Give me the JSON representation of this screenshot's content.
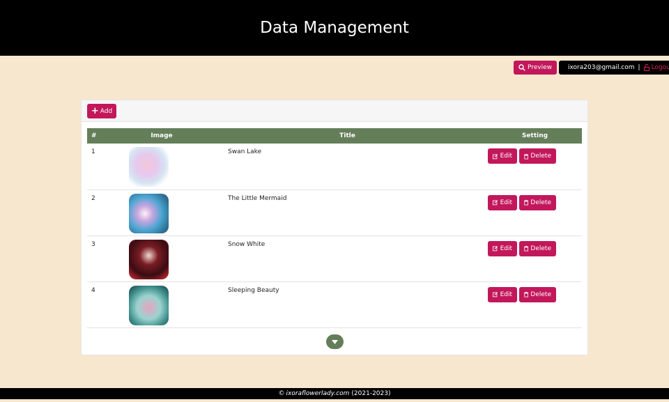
{
  "header": {
    "title": "Data Management"
  },
  "topbar": {
    "preview_label": "Preview",
    "user_email": "ixora203@gmail.com",
    "separator": "|",
    "logout_label": "Logout"
  },
  "toolbar": {
    "add_label": "Add"
  },
  "table": {
    "columns": [
      "#",
      "Image",
      "Title",
      "Setting"
    ],
    "rows": [
      {
        "num": "1",
        "title": "Swan Lake",
        "edit": "Edit",
        "delete": "Delete"
      },
      {
        "num": "2",
        "title": "The Little Mermaid",
        "edit": "Edit",
        "delete": "Delete"
      },
      {
        "num": "3",
        "title": "Snow White",
        "edit": "Edit",
        "delete": "Delete"
      },
      {
        "num": "4",
        "title": "Sleeping Beauty",
        "edit": "Edit",
        "delete": "Delete"
      }
    ]
  },
  "footer": {
    "copyright_symbol": "©",
    "site": "ixoraflowerlady.com",
    "years": "(2021-2023)"
  },
  "colors": {
    "accent": "#c2185b",
    "table_header": "#647e5a",
    "page_background": "#f7e7cf",
    "header_background": "#000000"
  }
}
